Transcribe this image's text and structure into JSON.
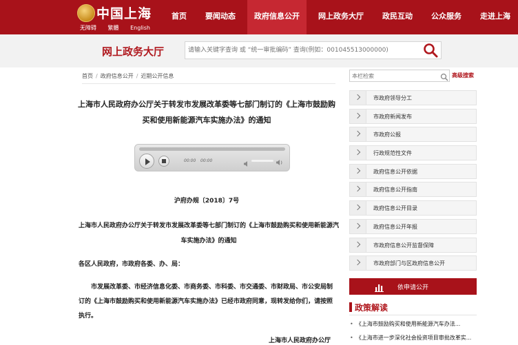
{
  "header": {
    "site_title": "中国上海",
    "lang_links": [
      "无障碍",
      "繁體",
      "English"
    ],
    "nav": [
      "首页",
      "要闻动态",
      "政府信息公开",
      "网上政务大厅",
      "政民互动",
      "公众服务",
      "走进上海"
    ],
    "active_nav": "政府信息公开",
    "brand_color": "#a8121a"
  },
  "search_band": {
    "title": "网上政务大厅",
    "placeholder": "请输入关键字查询 或 “统一审批编码” 查询(例如：001045513000000)",
    "icon": "search-icon"
  },
  "breadcrumb": [
    "首页",
    "政府信息公开",
    "近期公开信息"
  ],
  "article": {
    "title": "上海市人民政府办公厅关于转发市发展改革委等七部门制订的《上海市鼓励购买和使用新能源汽车实施办法》的通知",
    "player": {
      "current_time": "00:00",
      "total_time": "00:00"
    },
    "doc_number": "沪府办规〔2018〕7号",
    "sub_title": "上海市人民政府办公厅关于转发市发展改革委等七部门制订的《上海市鼓励购买和使用新能源汽车实施办法》的通知",
    "greeting": "各区人民政府，市政府各委、办、局：",
    "body": "市发展改革委、市经济信息化委、市商务委、市科委、市交通委、市财政局、市公安局制订的《上海市鼓励购买和使用新能源汽车实施办法》已经市政府同意，现转发给你们，请按照执行。",
    "signature": "上海市人民政府办公厅"
  },
  "sidebar": {
    "search_placeholder": "本栏检索",
    "advanced_search": "高级搜索",
    "menu": [
      "市政府领导分工",
      "市政府新闻发布",
      "市政府公报",
      "行政规范性文件",
      "政府信息公开依据",
      "政府信息公开指南",
      "政府信息公开目录",
      "政府信息公开年报",
      "市政府信息公开监督保障",
      "市政府部门与区政府信息公开"
    ],
    "apply_button": "依申请公开",
    "policy_title": "政策解读",
    "policy_items": [
      "《上海市鼓励购买和使用新能源汽车办法...",
      "《上海市进一步深化社会投资项目审批改革实..."
    ]
  }
}
